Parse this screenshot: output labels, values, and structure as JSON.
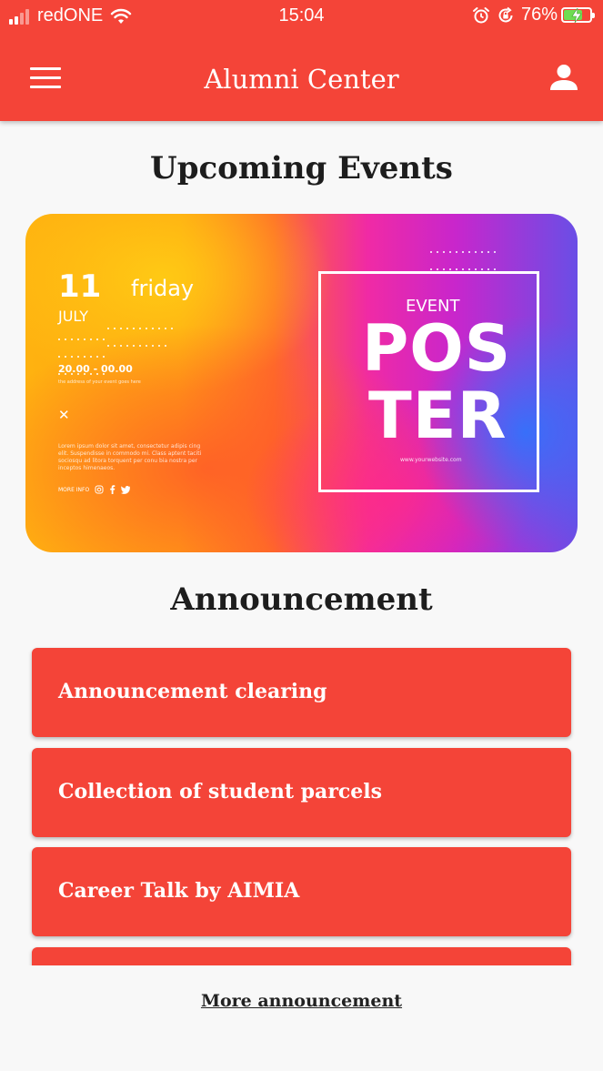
{
  "status_bar": {
    "carrier": "redONE",
    "time": "15:04",
    "battery": "76%",
    "battery_level": 0.76,
    "icons": [
      "signal-icon",
      "wifi-icon",
      "alarm-icon",
      "orientation-lock-icon",
      "battery-icon"
    ]
  },
  "app_bar": {
    "title": "Alumni Center",
    "menu_icon": "hamburger-menu-icon",
    "profile_icon": "user-profile-icon"
  },
  "events": {
    "title": "Upcoming Events",
    "poster": {
      "day": "11",
      "weekday": "friday",
      "month": "JULY",
      "time": "20.00 - 00.00",
      "subtext": "the address of your event goes here",
      "x_mark": "✕",
      "body": "Lorem ipsum dolor sit amet, consectetur adipis cing elit. Suspendisse in commodo mi. Class aptent taciti sociosqu ad litora torquent per conu bia nostra per inceptos himenaeos.",
      "more_info": "MORE INFO",
      "event_label": "EVENT",
      "poster_line1": "POS",
      "poster_line2": "TER",
      "website": "www.yourwebsite.com"
    }
  },
  "announcements": {
    "title": "Announcement",
    "items": [
      {
        "label": "Announcement clearing"
      },
      {
        "label": "Collection of student parcels"
      },
      {
        "label": "Career Talk by AIMIA"
      },
      {
        "label": ""
      }
    ],
    "more_label": "More announcement"
  },
  "colors": {
    "primary": "#f44438",
    "background": "#f8f8f8",
    "heading_text": "#1d1d1d"
  }
}
